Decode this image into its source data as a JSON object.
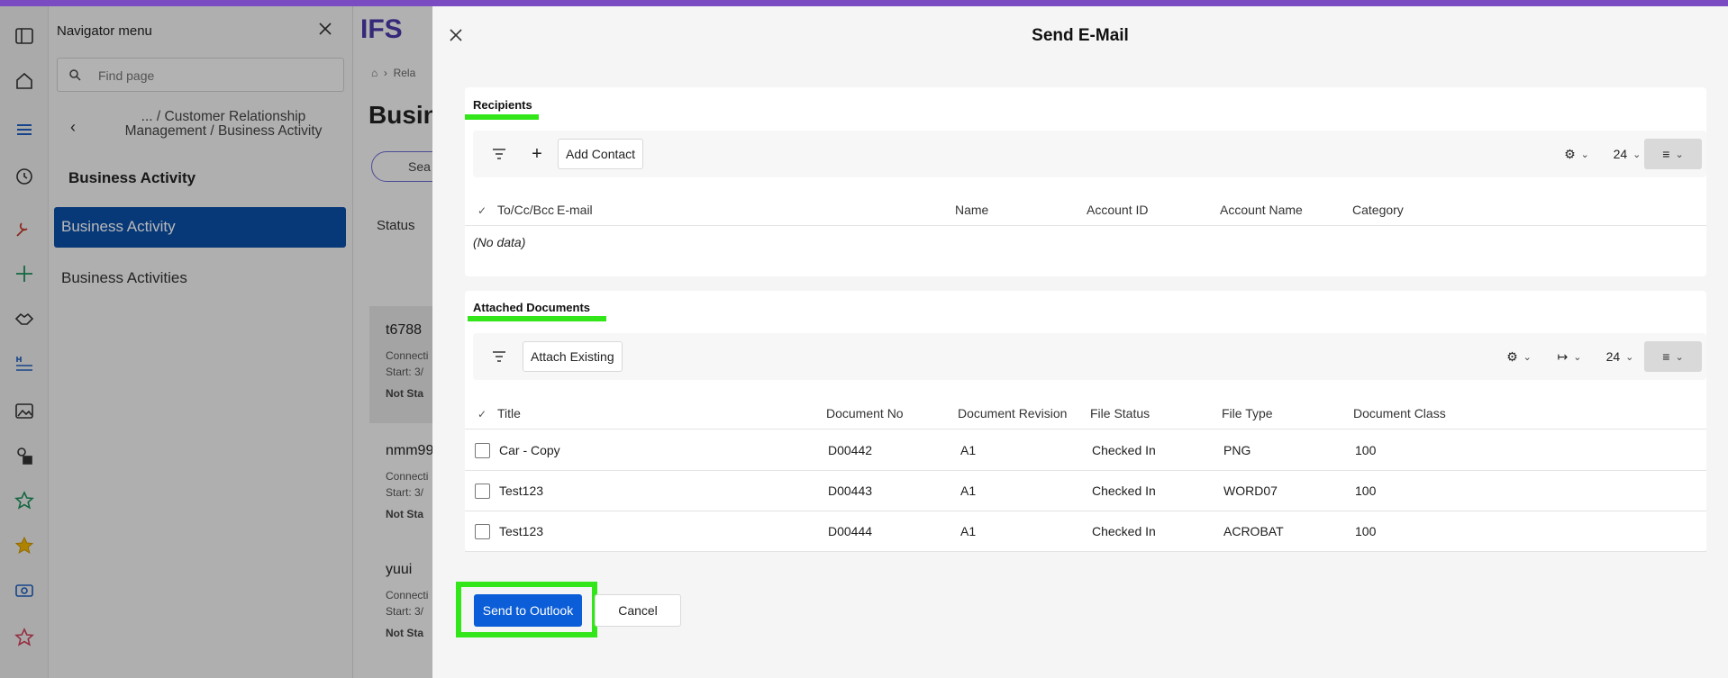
{
  "navigator": {
    "title": "Navigator menu",
    "search_placeholder": "Find page",
    "breadcrumb": "... / Customer Relationship Management / Business Activity",
    "section": "Business Activity",
    "items": [
      {
        "label": "Business Activity",
        "active": true
      },
      {
        "label": "Business Activities",
        "active": false
      }
    ]
  },
  "background": {
    "logo_text": "IFS",
    "crumb": "Rela",
    "page_title": "Busin",
    "search_label": "Sea",
    "status_label": "Status",
    "cards": [
      {
        "id": "t6788",
        "line1": "Connecti",
        "line2": "Start:  3/",
        "badge": "Not Sta"
      },
      {
        "id": "nmm99",
        "line1": "Connecti",
        "line2": "Start:  3/",
        "badge": "Not Sta"
      },
      {
        "id": "yuui",
        "line1": "Connecti",
        "line2": "Start:  3/",
        "badge": "Not Sta"
      }
    ]
  },
  "dialog": {
    "title": "Send E-Mail",
    "recipients": {
      "title": "Recipients",
      "add_contact_label": "Add Contact",
      "page_size": "24",
      "columns": [
        "To/Cc/Bcc",
        "E-mail",
        "Name",
        "Account ID",
        "Account Name",
        "Category"
      ],
      "empty_text": "(No data)"
    },
    "documents": {
      "title": "Attached Documents",
      "attach_existing_label": "Attach Existing",
      "page_size": "24",
      "columns": [
        "Title",
        "Document No",
        "Document Revision",
        "File Status",
        "File Type",
        "Document Class"
      ],
      "rows": [
        {
          "title": "Car - Copy",
          "doc_no": "D00442",
          "revision": "A1",
          "status": "Checked In",
          "type": "PNG",
          "class": "100"
        },
        {
          "title": "Test123",
          "doc_no": "D00443",
          "revision": "A1",
          "status": "Checked In",
          "type": "WORD07",
          "class": "100"
        },
        {
          "title": "Test123",
          "doc_no": "D00444",
          "revision": "A1",
          "status": "Checked In",
          "type": "ACROBAT",
          "class": "100"
        }
      ]
    },
    "send_label": "Send to Outlook",
    "cancel_label": "Cancel"
  },
  "colors": {
    "top_band": "#7b4bc2",
    "nav_active": "#0b4fa8",
    "primary_button": "#0b5ed7",
    "highlight": "#33e61a"
  }
}
